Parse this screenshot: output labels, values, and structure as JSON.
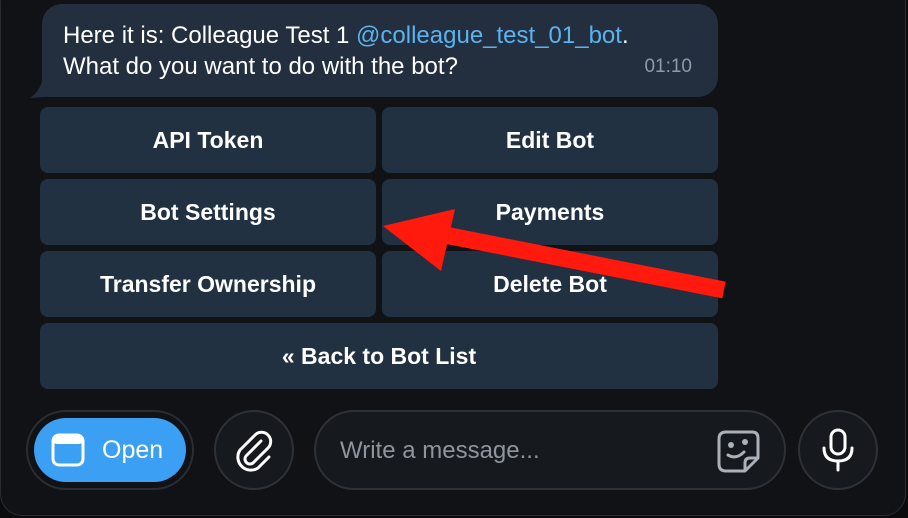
{
  "message": {
    "line1_prefix": "Here it is: Colleague Test 1 ",
    "mention": "@colleague_test_01_bot",
    "line1_suffix": ".",
    "line2": "What do you want to do with the bot?",
    "time": "01:10"
  },
  "keyboard": {
    "api_token": "API Token",
    "edit_bot": "Edit Bot",
    "bot_settings": "Bot Settings",
    "payments": "Payments",
    "transfer_ownership": "Transfer Ownership",
    "delete_bot": "Delete Bot",
    "back": "« Back to Bot List"
  },
  "composer": {
    "open_label": "Open",
    "placeholder": "Write a message..."
  },
  "icons": {
    "open": "window-icon",
    "attach": "paperclip-icon",
    "sticker": "sticker-face-icon",
    "voice": "microphone-icon",
    "annotation": "red-arrow-icon"
  },
  "colors": {
    "accent": "#3ba0f3",
    "mention": "#5ab3f0",
    "annotation_arrow": "#ff1a0d"
  }
}
